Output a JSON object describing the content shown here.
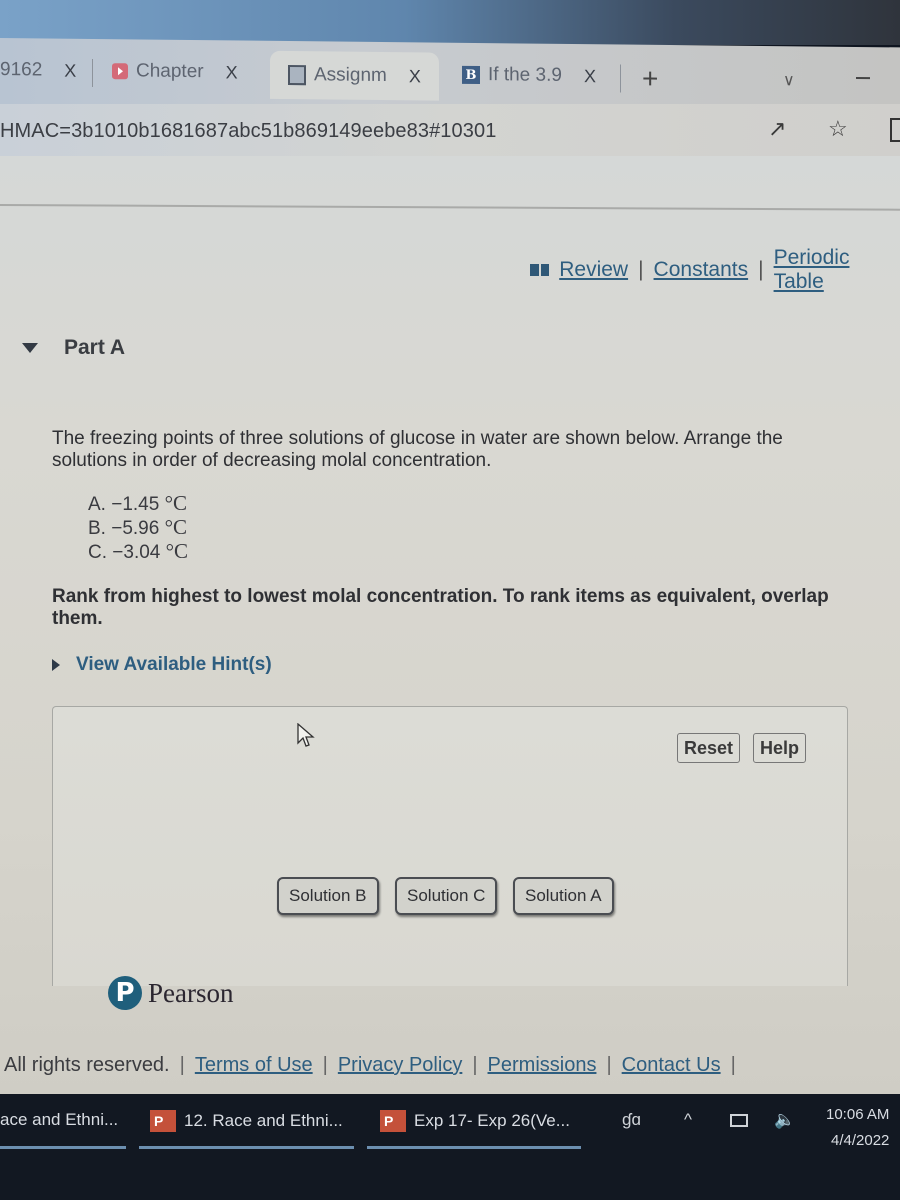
{
  "browser": {
    "tabs": [
      {
        "label": "9162",
        "icon": "generic-tab-icon",
        "active": false
      },
      {
        "label": "Chapter",
        "icon": "youtube-icon",
        "active": false
      },
      {
        "label": "Assignm",
        "icon": "document-icon",
        "active": true
      },
      {
        "label": "If the 3.9",
        "icon": "bartleby-icon",
        "active": false
      }
    ],
    "close_glyph": "X",
    "new_tab_glyph": "+",
    "tab_list_glyph": "∨",
    "url": "HMAC=3b1010b1681687abc51b869149eebe83#10301",
    "share_glyph": "↗",
    "favorite_glyph": "☆"
  },
  "resources": {
    "links": [
      "Review",
      "Constants",
      "Periodic Table"
    ],
    "separator": "|"
  },
  "part": {
    "title": "Part A",
    "question": "The freezing points of three solutions of glucose in water are shown below. Arrange the solutions in order of decreasing molal concentration.",
    "options": [
      {
        "label": "A.",
        "value": "−1.45",
        "unit": "°C"
      },
      {
        "label": "B.",
        "value": "−5.96",
        "unit": "°C"
      },
      {
        "label": "C.",
        "value": "−3.04",
        "unit": "°C"
      }
    ],
    "instructions": "Rank from highest to lowest molal concentration. To rank items as equivalent, overlap them.",
    "hint_label": "View Available Hint(s)"
  },
  "ranking": {
    "reset_label": "Reset",
    "help_label": "Help",
    "items": [
      "Solution B",
      "Solution C",
      "Solution A"
    ]
  },
  "brand": {
    "name": "Pearson",
    "logo_letter": "P"
  },
  "footer": {
    "copyright": "All rights reserved.",
    "links": [
      "Terms of Use",
      "Privacy Policy",
      "Permissions",
      "Contact Us"
    ],
    "separator": "|"
  },
  "taskbar": {
    "items": [
      {
        "label": "ace and Ethni...",
        "icon": ""
      },
      {
        "label": "12. Race and Ethni...",
        "icon": "P"
      },
      {
        "label": "Exp 17- Exp 26(Ve...",
        "icon": "P"
      }
    ],
    "time": "10:06 AM",
    "date": "4/4/2022",
    "tray_people_glyph": "ɠɑ",
    "tray_chevron_glyph": "^",
    "tray_volume_glyph": "🔈"
  }
}
